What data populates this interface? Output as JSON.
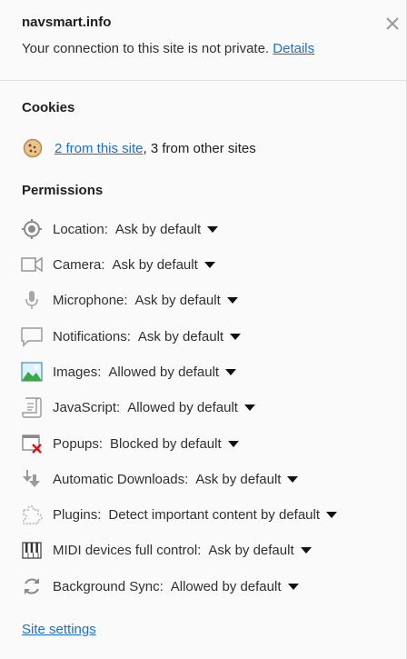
{
  "header": {
    "site": "navsmart.info",
    "connection_text": "Your connection to this site is not private.",
    "details_link": "Details"
  },
  "cookies": {
    "title": "Cookies",
    "link_text": "2 from this site",
    "other_text": ", 3 from other sites"
  },
  "permissions": {
    "title": "Permissions",
    "items": [
      {
        "label": "Location:",
        "value": "Ask by default",
        "icon": "location-icon"
      },
      {
        "label": "Camera:",
        "value": "Ask by default",
        "icon": "camera-icon"
      },
      {
        "label": "Microphone:",
        "value": "Ask by default",
        "icon": "microphone-icon"
      },
      {
        "label": "Notifications:",
        "value": "Ask by default",
        "icon": "notifications-icon"
      },
      {
        "label": "Images:",
        "value": "Allowed by default",
        "icon": "images-icon"
      },
      {
        "label": "JavaScript:",
        "value": "Allowed by default",
        "icon": "javascript-icon"
      },
      {
        "label": "Popups:",
        "value": "Blocked by default",
        "icon": "popups-blocked-icon"
      },
      {
        "label": "Automatic Downloads:",
        "value": "Ask by default",
        "icon": "downloads-icon"
      },
      {
        "label": "Plugins:",
        "value": "Detect important content by default",
        "icon": "plugin-icon"
      },
      {
        "label": "MIDI devices full control:",
        "value": "Ask by default",
        "icon": "midi-icon"
      },
      {
        "label": "Background Sync:",
        "value": "Allowed by default",
        "icon": "sync-icon"
      }
    ]
  },
  "footer": {
    "site_settings": "Site settings"
  }
}
